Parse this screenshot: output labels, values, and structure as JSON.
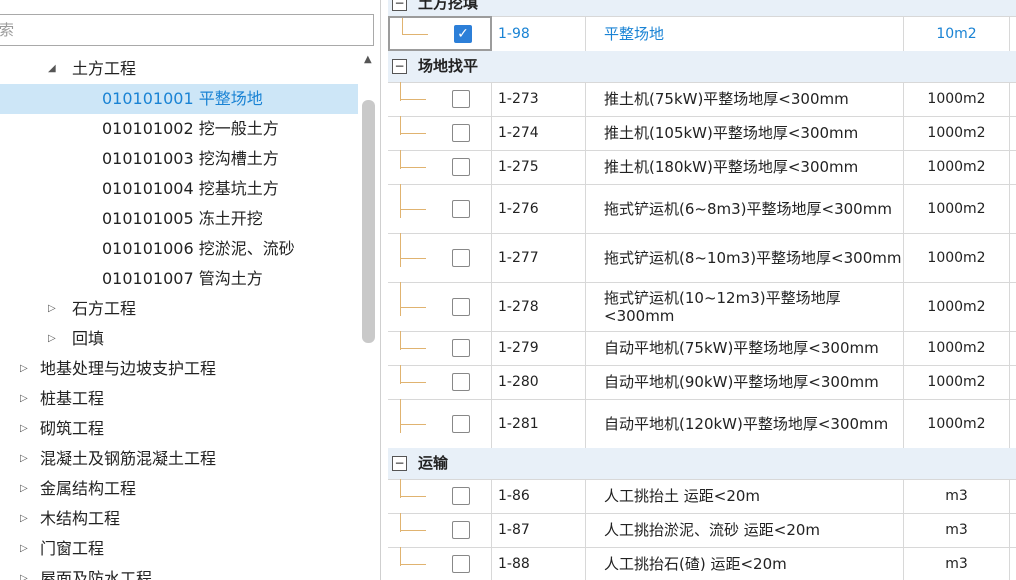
{
  "search": {
    "placeholder": "索"
  },
  "tree": [
    {
      "label": "土方工程",
      "depth": 1,
      "arrow": "▲",
      "expanded": true
    },
    {
      "label": "010101001  平整场地",
      "depth": 2,
      "selected": true
    },
    {
      "label": "010101002  挖一般土方",
      "depth": 2
    },
    {
      "label": "010101003  挖沟槽土方",
      "depth": 2
    },
    {
      "label": "010101004  挖基坑土方",
      "depth": 2
    },
    {
      "label": "010101005  冻土开挖",
      "depth": 2
    },
    {
      "label": "010101006  挖淤泥、流砂",
      "depth": 2
    },
    {
      "label": "010101007  管沟土方",
      "depth": 2
    },
    {
      "label": "石方工程",
      "depth": 1,
      "arrow": "▶"
    },
    {
      "label": "回填",
      "depth": 1,
      "arrow": "▶"
    },
    {
      "label": "地基处理与边坡支护工程",
      "depth": 0,
      "arrow": "▶"
    },
    {
      "label": "桩基工程",
      "depth": 0,
      "arrow": "▶"
    },
    {
      "label": "砌筑工程",
      "depth": 0,
      "arrow": "▶"
    },
    {
      "label": "混凝土及钢筋混凝土工程",
      "depth": 0,
      "arrow": "▶"
    },
    {
      "label": "金属结构工程",
      "depth": 0,
      "arrow": "▶"
    },
    {
      "label": "木结构工程",
      "depth": 0,
      "arrow": "▶"
    },
    {
      "label": "门窗工程",
      "depth": 0,
      "arrow": "▶"
    },
    {
      "label": "屋面及防水工程",
      "depth": 0,
      "arrow": "▶"
    }
  ],
  "right": {
    "group_top": "土方挖填",
    "first_row": {
      "code": "1-98",
      "name": "平整场地",
      "unit": "10m2",
      "checked": true
    },
    "groups": [
      {
        "title": "场地找平",
        "rows": [
          {
            "code": "1-273",
            "name": "推土机(75kW)平整场地厚<300mm",
            "unit": "1000m2",
            "tall": false
          },
          {
            "code": "1-274",
            "name": "推土机(105kW)平整场地厚<300mm",
            "unit": "1000m2",
            "tall": false
          },
          {
            "code": "1-275",
            "name": "推土机(180kW)平整场地厚<300mm",
            "unit": "1000m2",
            "tall": false
          },
          {
            "code": "1-276",
            "name": "拖式铲运机(6~8m3)平整场地厚<300mm",
            "unit": "1000m2",
            "tall": true
          },
          {
            "code": "1-277",
            "name": "拖式铲运机(8~10m3)平整场地厚<300mm",
            "unit": "1000m2",
            "tall": true
          },
          {
            "code": "1-278",
            "name": "拖式铲运机(10~12m3)平整场地厚<300mm",
            "unit": "1000m2",
            "tall": true
          },
          {
            "code": "1-279",
            "name": "自动平地机(75kW)平整场地厚<300mm",
            "unit": "1000m2",
            "tall": false
          },
          {
            "code": "1-280",
            "name": "自动平地机(90kW)平整场地厚<300mm",
            "unit": "1000m2",
            "tall": false
          },
          {
            "code": "1-281",
            "name": "自动平地机(120kW)平整场地厚<300mm",
            "unit": "1000m2",
            "tall": true
          }
        ]
      },
      {
        "title": "运输",
        "rows": [
          {
            "code": "1-86",
            "name": "人工挑抬土 运距<20m",
            "unit": "m3",
            "tall": false
          },
          {
            "code": "1-87",
            "name": "人工挑抬淤泥、流砂 运距<20m",
            "unit": "m3",
            "tall": false
          },
          {
            "code": "1-88",
            "name": "人工挑抬石(碴) 运距<20m",
            "unit": "m3",
            "tall": false
          }
        ]
      }
    ]
  }
}
